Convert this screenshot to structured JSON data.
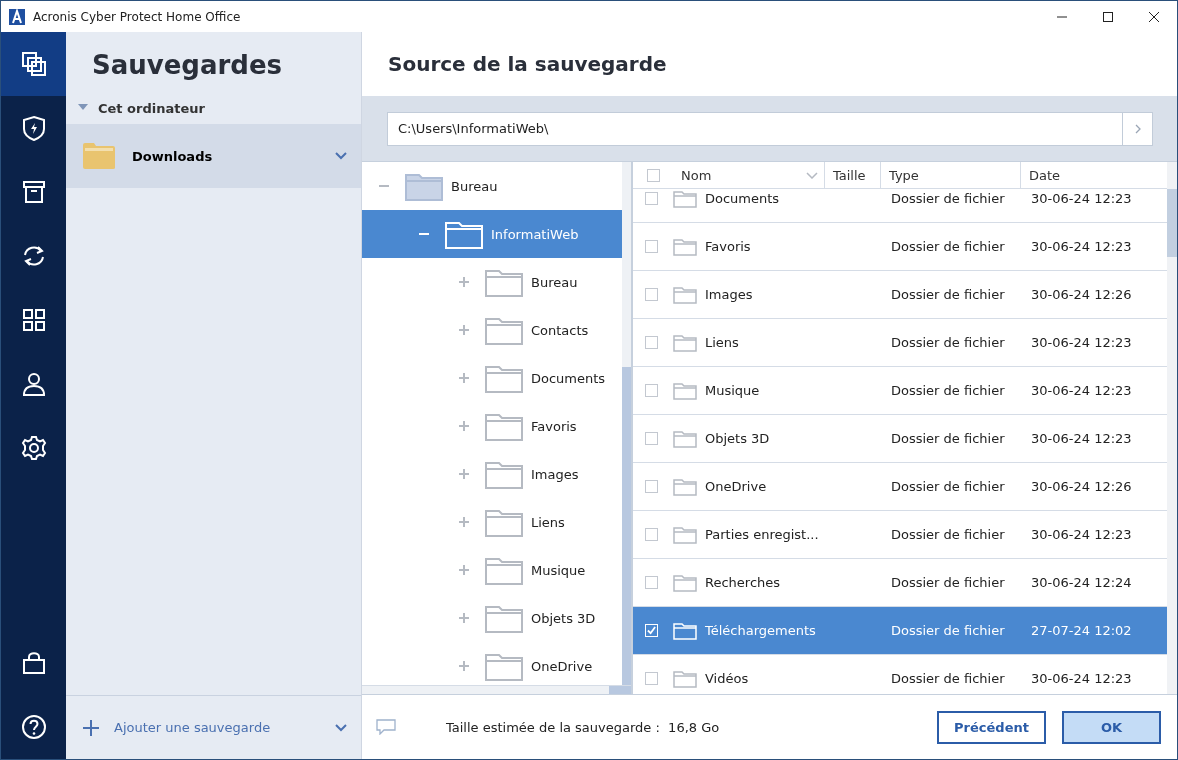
{
  "window": {
    "title": "Acronis Cyber Protect Home Office"
  },
  "nav": {
    "top": [
      {
        "kind": "backup",
        "selected": true
      },
      {
        "kind": "shield",
        "selected": false
      },
      {
        "kind": "archive",
        "selected": false
      },
      {
        "kind": "sync",
        "selected": false
      },
      {
        "kind": "grid",
        "selected": false
      },
      {
        "kind": "account",
        "selected": false
      },
      {
        "kind": "settings",
        "selected": false
      }
    ],
    "bottom": [
      {
        "kind": "store",
        "selected": false
      },
      {
        "kind": "help",
        "selected": false
      }
    ]
  },
  "sidebar": {
    "title": "Sauvegardes",
    "group": {
      "label": "Cet ordinateur",
      "expanded": true
    },
    "items": [
      {
        "label": "Downloads",
        "selected": true
      }
    ],
    "add_label": "Ajouter une sauvegarde"
  },
  "main": {
    "title": "Source de la sauvegarde",
    "path": "C:\\Users\\InformatiWeb\\"
  },
  "tree": [
    {
      "label": "Bureau",
      "kind": "root",
      "expanded": true,
      "selected": false,
      "children": [
        {
          "label": "InformatiWeb",
          "kind": "folder",
          "expanded": true,
          "selected": true,
          "children": [
            {
              "label": "Bureau",
              "kind": "folder",
              "expanded": false,
              "selected": false
            },
            {
              "label": "Contacts",
              "kind": "folder",
              "expanded": false,
              "selected": false
            },
            {
              "label": "Documents",
              "kind": "folder",
              "expanded": false,
              "selected": false
            },
            {
              "label": "Favoris",
              "kind": "folder",
              "expanded": false,
              "selected": false
            },
            {
              "label": "Images",
              "kind": "folder",
              "expanded": false,
              "selected": false
            },
            {
              "label": "Liens",
              "kind": "folder",
              "expanded": false,
              "selected": false
            },
            {
              "label": "Musique",
              "kind": "folder",
              "expanded": false,
              "selected": false
            },
            {
              "label": "Objets 3D",
              "kind": "folder",
              "expanded": false,
              "selected": false
            },
            {
              "label": "OneDrive",
              "kind": "folder",
              "expanded": false,
              "selected": false
            }
          ]
        }
      ]
    }
  ],
  "table": {
    "all_checked": false,
    "columns": [
      "Nom",
      "Taille",
      "Type",
      "Date"
    ],
    "rows": [
      {
        "name": "Documents",
        "type": "Dossier de fichier",
        "date": "30-06-24 12:23",
        "checked": false,
        "selected": false
      },
      {
        "name": "Favoris",
        "type": "Dossier de fichier",
        "date": "30-06-24 12:23",
        "checked": false,
        "selected": false
      },
      {
        "name": "Images",
        "type": "Dossier de fichier",
        "date": "30-06-24 12:26",
        "checked": false,
        "selected": false
      },
      {
        "name": "Liens",
        "type": "Dossier de fichier",
        "date": "30-06-24 12:23",
        "checked": false,
        "selected": false
      },
      {
        "name": "Musique",
        "type": "Dossier de fichier",
        "date": "30-06-24 12:23",
        "checked": false,
        "selected": false
      },
      {
        "name": "Objets 3D",
        "type": "Dossier de fichier",
        "date": "30-06-24 12:23",
        "checked": false,
        "selected": false
      },
      {
        "name": "OneDrive",
        "type": "Dossier de fichier",
        "date": "30-06-24 12:26",
        "checked": false,
        "selected": false
      },
      {
        "name": "Parties enregist...",
        "type": "Dossier de fichier",
        "date": "30-06-24 12:23",
        "checked": false,
        "selected": false
      },
      {
        "name": "Recherches",
        "type": "Dossier de fichier",
        "date": "30-06-24 12:24",
        "checked": false,
        "selected": false
      },
      {
        "name": "Téléchargements",
        "type": "Dossier de fichier",
        "date": "27-07-24 12:02",
        "checked": true,
        "selected": true
      },
      {
        "name": "Vidéos",
        "type": "Dossier de fichier",
        "date": "30-06-24 12:23",
        "checked": false,
        "selected": false
      }
    ]
  },
  "footer": {
    "estimate": "Taille estimée de la sauvegarde :  16,8 Go",
    "buttons": [
      {
        "label": "Précédent",
        "kind": "secondary"
      },
      {
        "label": "OK",
        "kind": "primary"
      }
    ]
  }
}
